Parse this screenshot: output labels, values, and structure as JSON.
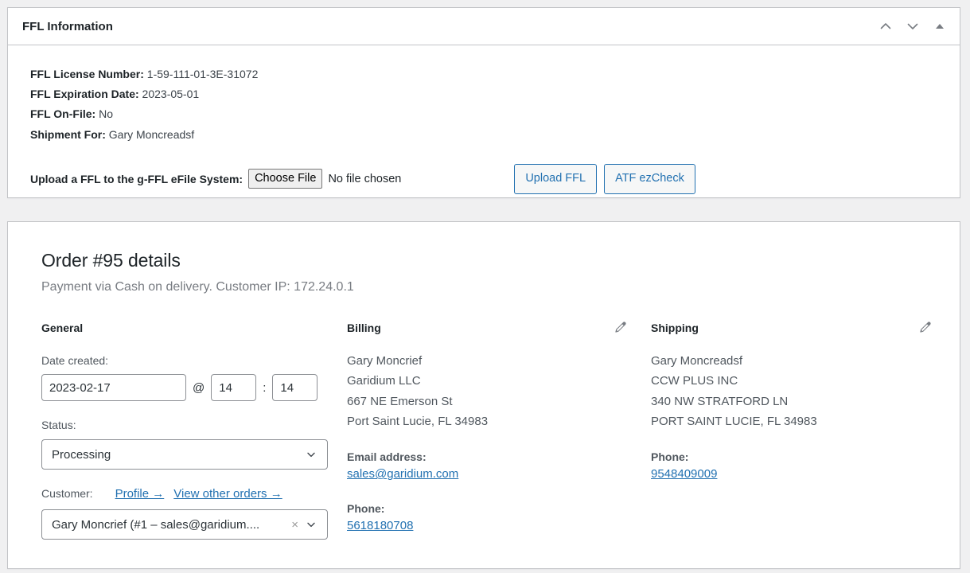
{
  "ffl_panel": {
    "title": "FFL Information",
    "handle_icons": [
      "chevron-up-icon",
      "chevron-down-icon",
      "toggle-triangle-up-icon"
    ],
    "rows": [
      {
        "label": "FFL License Number:",
        "value": "1-59-111-01-3E-31072"
      },
      {
        "label": "FFL Expiration Date:",
        "value": "2023-05-01"
      },
      {
        "label": "FFL On-File:",
        "value": "No"
      },
      {
        "label": "Shipment For:",
        "value": "Gary Moncreadsf"
      }
    ],
    "upload": {
      "label": "Upload a FFL to the g-FFL eFile System:",
      "choose_file_label": "Choose File",
      "file_status": "No file chosen"
    },
    "buttons": [
      {
        "label": "Upload FFL"
      },
      {
        "label": "ATF ezCheck"
      }
    ]
  },
  "order_panel": {
    "title": "Order #95 details",
    "subtitle": "Payment via Cash on delivery. Customer IP: 172.24.0.1",
    "general": {
      "heading": "General",
      "date_label": "Date created:",
      "date_value": "2023-02-17",
      "at_symbol": "@",
      "hour_value": "14",
      "colon_symbol": ":",
      "minute_value": "14",
      "status_label": "Status:",
      "status_value": "Processing",
      "customer_label": "Customer:",
      "profile_link": "Profile →",
      "other_orders_link": "View other orders →",
      "customer_value": "Gary Moncrief (#1 – sales@garidium....",
      "clear_symbol": "×"
    },
    "billing": {
      "heading": "Billing",
      "edit_icon": "pencil-icon",
      "address": [
        "Gary Moncrief",
        "Garidium LLC",
        "667 NE Emerson St",
        "Port Saint Lucie, FL 34983"
      ],
      "email_label": "Email address:",
      "email_value": "sales@garidium.com",
      "phone_label": "Phone:",
      "phone_value": "5618180708"
    },
    "shipping": {
      "heading": "Shipping",
      "edit_icon": "pencil-icon",
      "address": [
        "Gary Moncreadsf",
        "CCW PLUS INC",
        "340 NW STRATFORD LN",
        "PORT SAINT LUCIE, FL 34983"
      ],
      "phone_label": "Phone:",
      "phone_value": "9548409009"
    }
  },
  "colors": {
    "link": "#2271b1",
    "page_background": "#f0f0f1",
    "panel_border": "#c3c4c7",
    "heading": "#1d2327",
    "muted_text": "#787c82"
  }
}
